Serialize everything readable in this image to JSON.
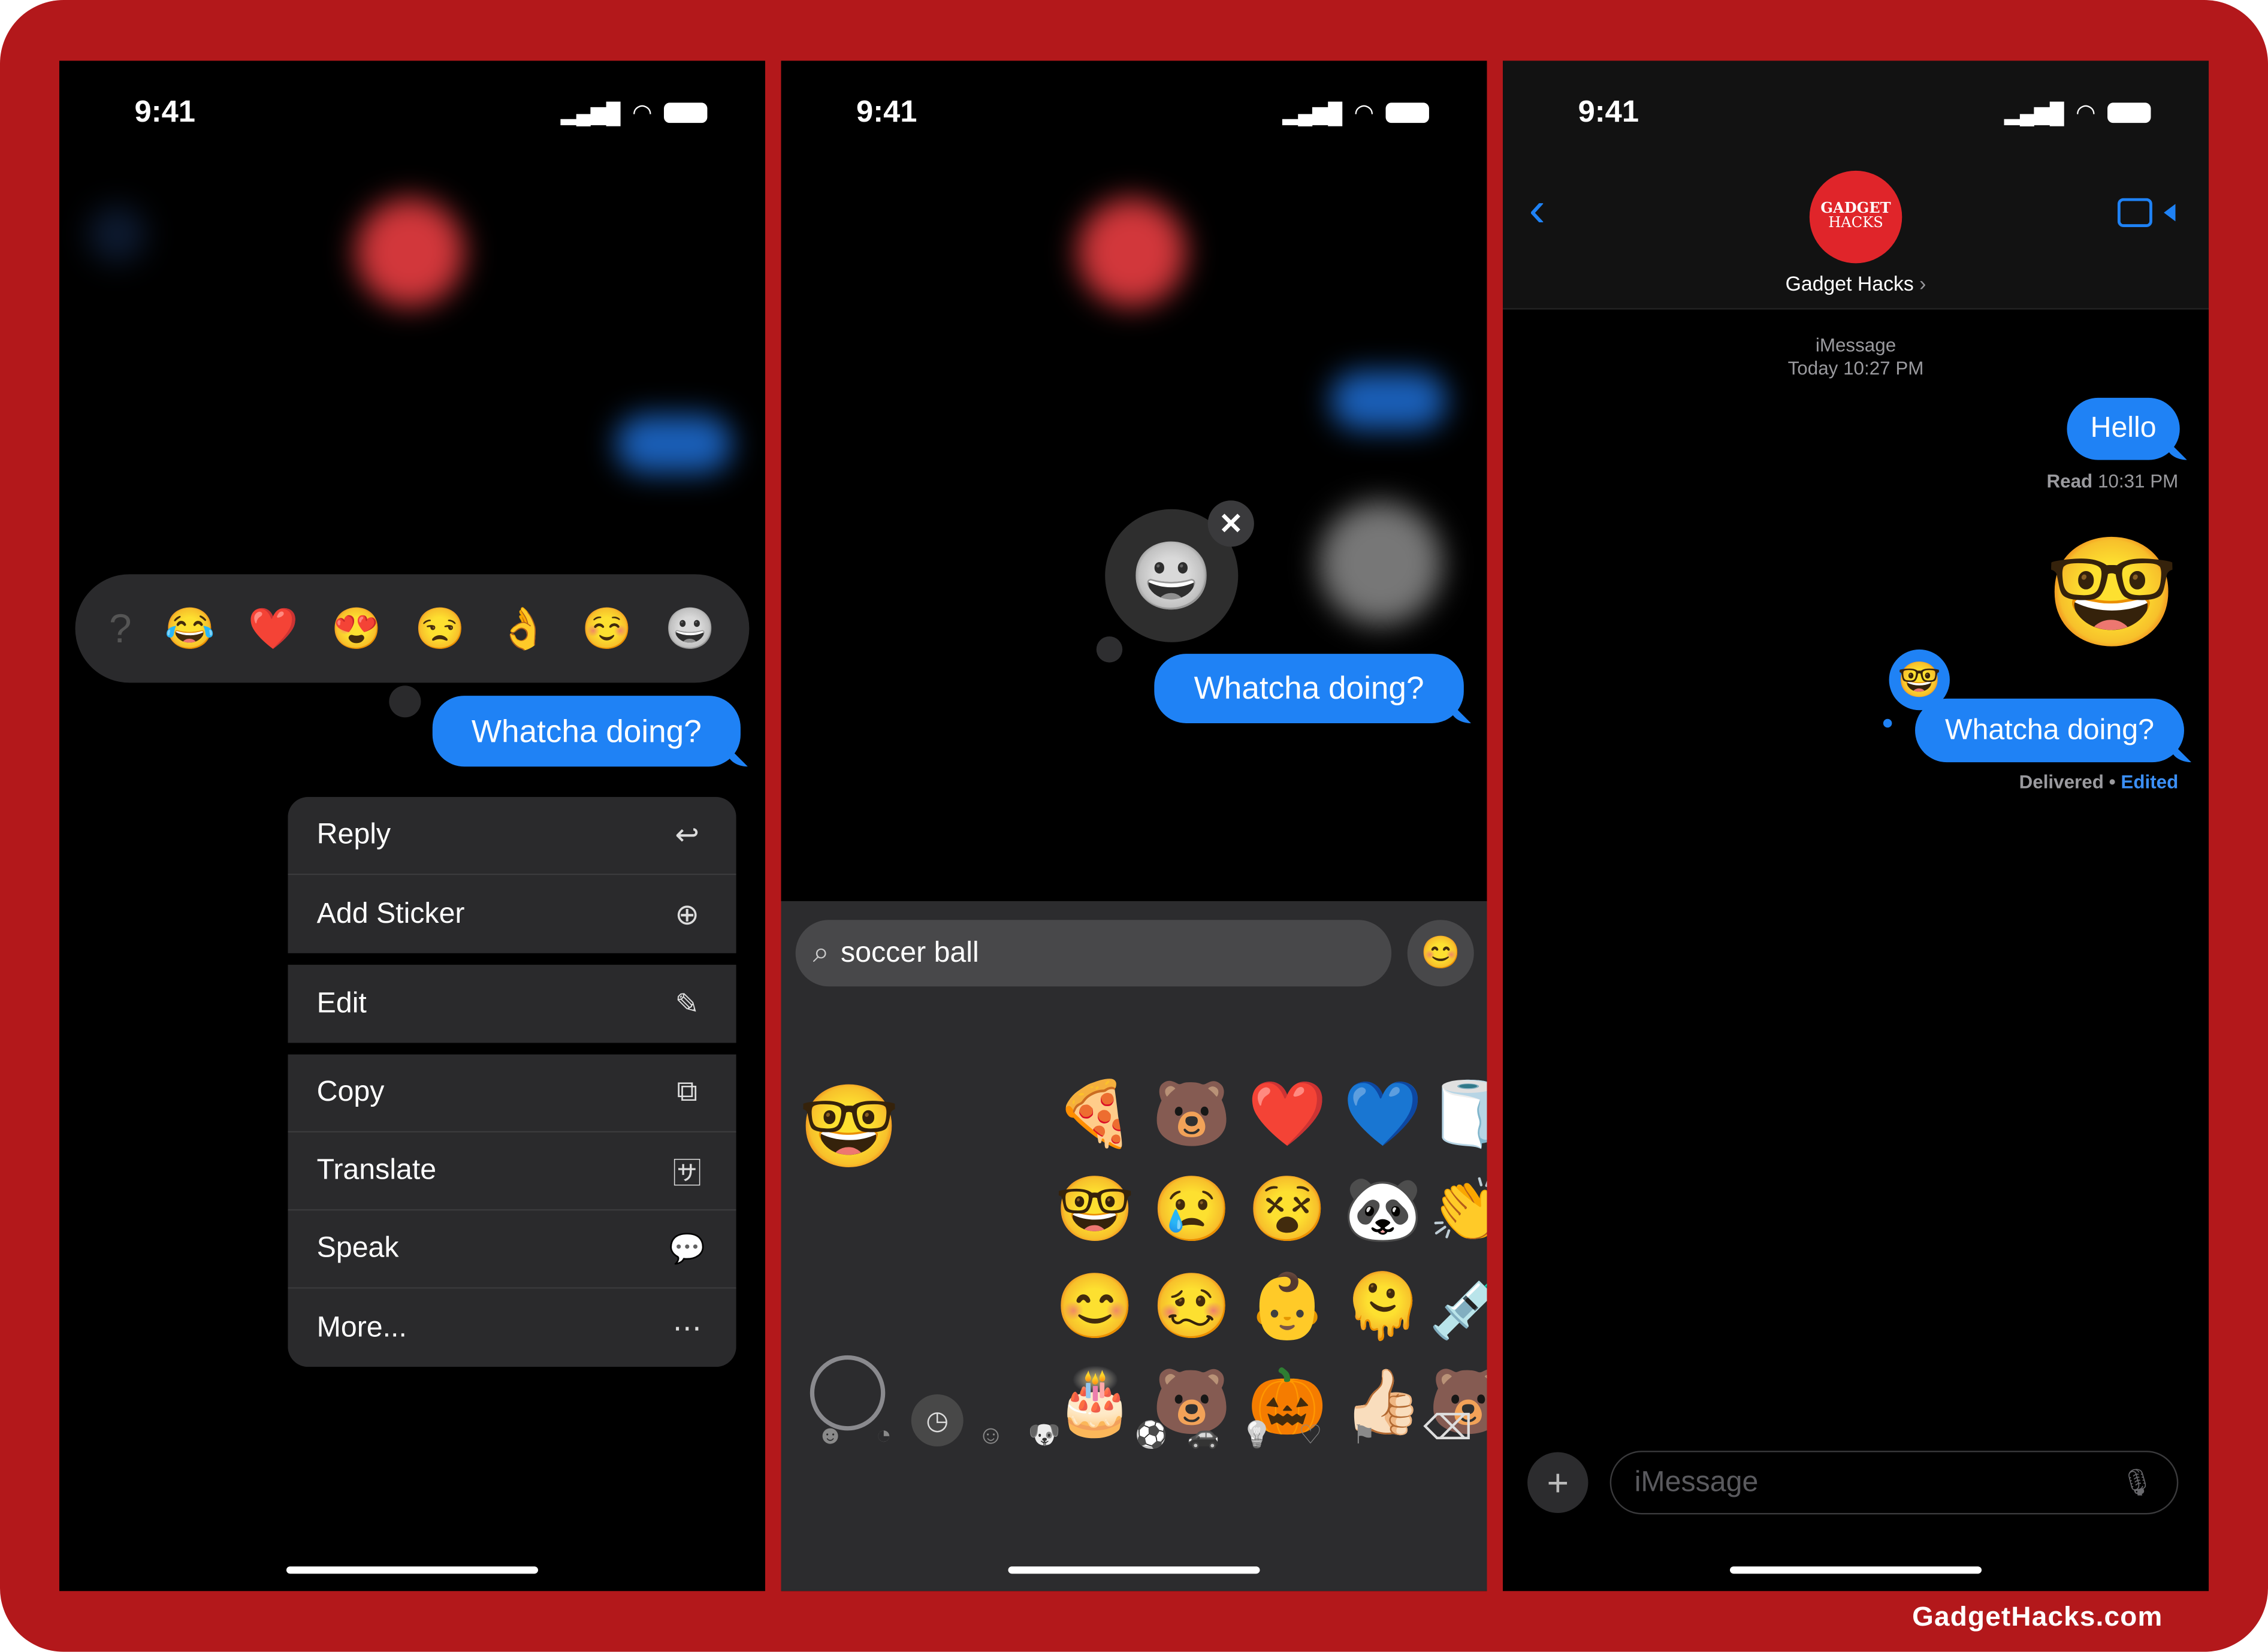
{
  "status": {
    "time": "9:41"
  },
  "left": {
    "reactions": [
      "?",
      "😂",
      "❤️",
      "😍",
      "😒",
      "👌",
      "☺️",
      "😀"
    ],
    "message": "Whatcha doing?",
    "menu": [
      {
        "label": "Reply",
        "icon": "reply-icon",
        "glyph": "↩"
      },
      {
        "label": "Add Sticker",
        "icon": "add-sticker-icon",
        "glyph": "⊕"
      },
      {
        "label": "Edit",
        "icon": "pencil-icon",
        "glyph": "✎"
      },
      {
        "label": "Copy",
        "icon": "copy-icon",
        "glyph": "⧉"
      },
      {
        "label": "Translate",
        "icon": "translate-icon",
        "glyph": "🈂"
      },
      {
        "label": "Speak",
        "icon": "speak-icon",
        "glyph": "💬"
      },
      {
        "label": "More...",
        "icon": "more-icon",
        "glyph": "⋯"
      }
    ]
  },
  "middle": {
    "message": "Whatcha doing?",
    "search": {
      "value": "soccer ball"
    },
    "stickers": [
      [
        "🍕",
        "🐻",
        "❤️",
        "💙",
        "🧻"
      ],
      [
        "🤓",
        "😢",
        "😵",
        "🐼",
        "👏"
      ],
      [
        "😊",
        "🥴",
        "👶",
        "🫠",
        "💉"
      ],
      [
        "🎂",
        "🐻",
        "🎃",
        "👍🏻",
        "🐻"
      ]
    ],
    "sticker_preview": "🤓",
    "categories": [
      "memoji-icon",
      "stickers-icon",
      "recent-icon",
      "smileys-icon",
      "animals-icon",
      "food-icon",
      "activity-icon",
      "travel-icon",
      "objects-icon",
      "symbols-icon",
      "flags-icon"
    ],
    "category_glyphs": [
      "☻",
      "◔",
      "◷",
      "☺",
      "🐶",
      "",
      "⚽",
      "🚗",
      "💡",
      "♡",
      "⚑"
    ],
    "selected_category": "recent-icon"
  },
  "right": {
    "contact": {
      "name": "Gadget Hacks",
      "avatar_line1": "GADGET",
      "avatar_line2": "HACKS"
    },
    "service": "iMessage",
    "timestamp": "Today 10:27 PM",
    "messages": [
      {
        "text": "Hello",
        "status_label": "Read",
        "status_time": "10:31 PM"
      },
      {
        "sticker": "🤓"
      },
      {
        "text": "Whatcha doing?",
        "status_label": "Delivered",
        "separator": "•",
        "edited": "Edited"
      }
    ],
    "input_placeholder": "iMessage"
  },
  "watermark": "GadgetHacks.com",
  "colors": {
    "frame": "#b3181b",
    "bubble": "#1f82f5",
    "link": "#3b8ff6",
    "keyboard": "#2c2c2e"
  }
}
